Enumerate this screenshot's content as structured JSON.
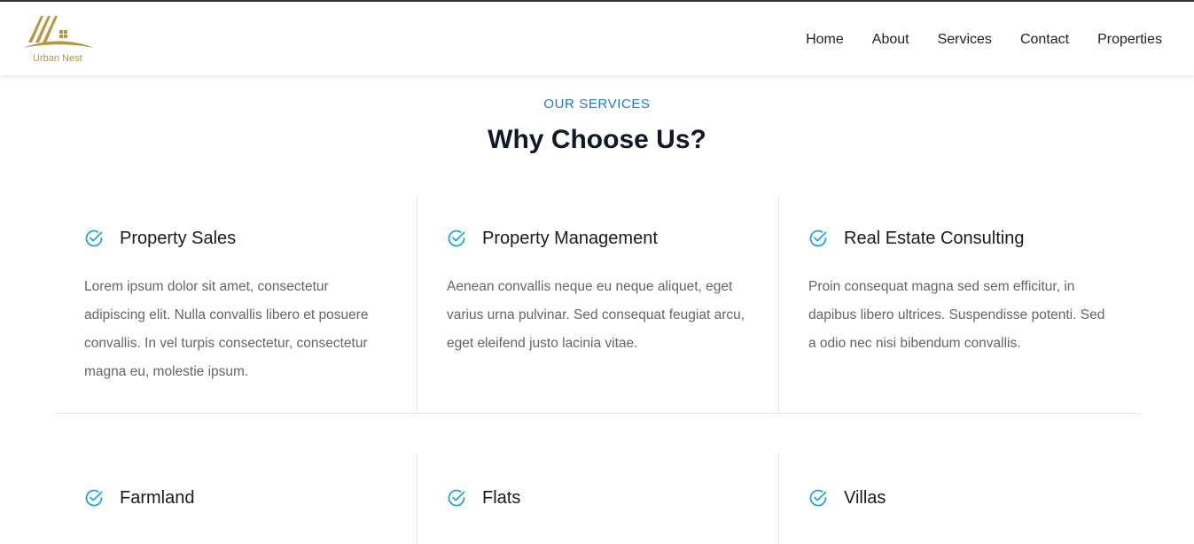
{
  "header": {
    "logo_text": "Urban Nest",
    "nav": [
      "Home",
      "About",
      "Services",
      "Contact",
      "Properties"
    ]
  },
  "section": {
    "eyebrow": "OUR SERVICES",
    "title": "Why Choose Us?"
  },
  "services": [
    {
      "title": "Property Sales",
      "body": "Lorem ipsum dolor sit amet, consectetur adipiscing elit. Nulla convallis libero et posuere convallis. In vel turpis consectetur, consectetur magna eu, molestie ipsum."
    },
    {
      "title": "Property Management",
      "body": "Aenean convallis neque eu neque aliquet, eget varius urna pulvinar. Sed consequat feugiat arcu, eget eleifend justo lacinia vitae."
    },
    {
      "title": "Real Estate Consulting",
      "body": "Proin consequat magna sed sem efficitur, in dapibus libero ultrices. Suspendisse potenti. Sed a odio nec nisi bibendum convallis."
    },
    {
      "title": "Farmland",
      "body": ""
    },
    {
      "title": "Flats",
      "body": ""
    },
    {
      "title": "Villas",
      "body": ""
    }
  ],
  "colors": {
    "accent": "#2079c4",
    "check": "#1ea7d6",
    "logo": "#b8963e"
  },
  "icons": {
    "logo": "house-roof-logo-icon",
    "service": "check-circle-icon"
  }
}
